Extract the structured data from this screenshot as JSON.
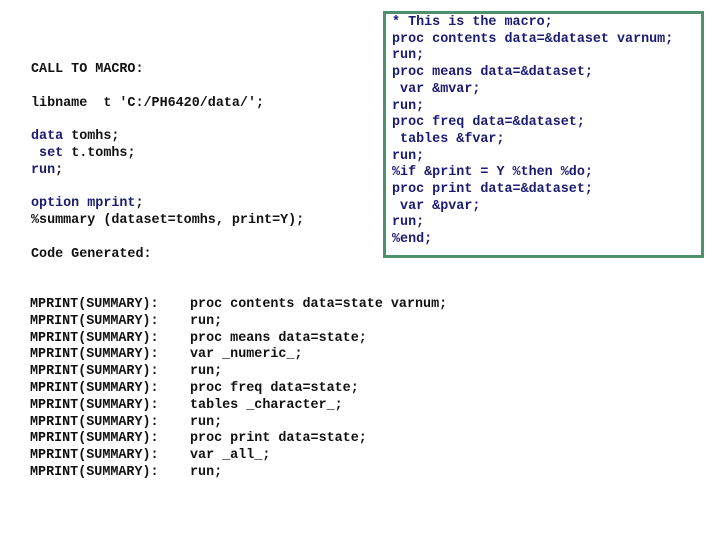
{
  "left_panel": {
    "call_heading": "CALL TO MACRO:",
    "libname_line": "libname  t 'C:/PH6420/data/';",
    "data_step": [
      {
        "keyword": "data",
        "rest": " tomhs;"
      },
      {
        "keyword": " set",
        "rest": " t.tomhs;"
      },
      {
        "keyword": "run",
        "rest": ";"
      }
    ],
    "option_line": {
      "keyword": "option mprint",
      "rest": ";"
    },
    "macro_call": "%summary (dataset=tomhs, print=Y);",
    "generated_heading": "Code Generated:"
  },
  "macro_box": {
    "lines": [
      "* This is the macro;",
      "proc contents data=&dataset varnum;",
      "run;",
      "proc means data=&dataset;",
      " var &mvar;",
      "run;",
      "proc freq data=&dataset;",
      " tables &fvar;",
      "run;",
      "%if &print = Y %then %do;",
      "proc print data=&dataset;",
      " var &pvar;",
      "run;",
      "%end;"
    ]
  },
  "mprint": {
    "label": "MPRINT(SUMMARY):",
    "lines": [
      "proc contents data=state varnum;",
      "run;",
      "proc means data=state;",
      "var _numeric_;",
      "run;",
      "proc freq data=state;",
      "tables _character_;",
      "run;",
      "proc print data=state;",
      "var _all_;",
      "run;"
    ]
  },
  "colors": {
    "box_border": "#4e8f6e",
    "keyword_text": "#1a1a70",
    "plain_text": "#111111"
  }
}
